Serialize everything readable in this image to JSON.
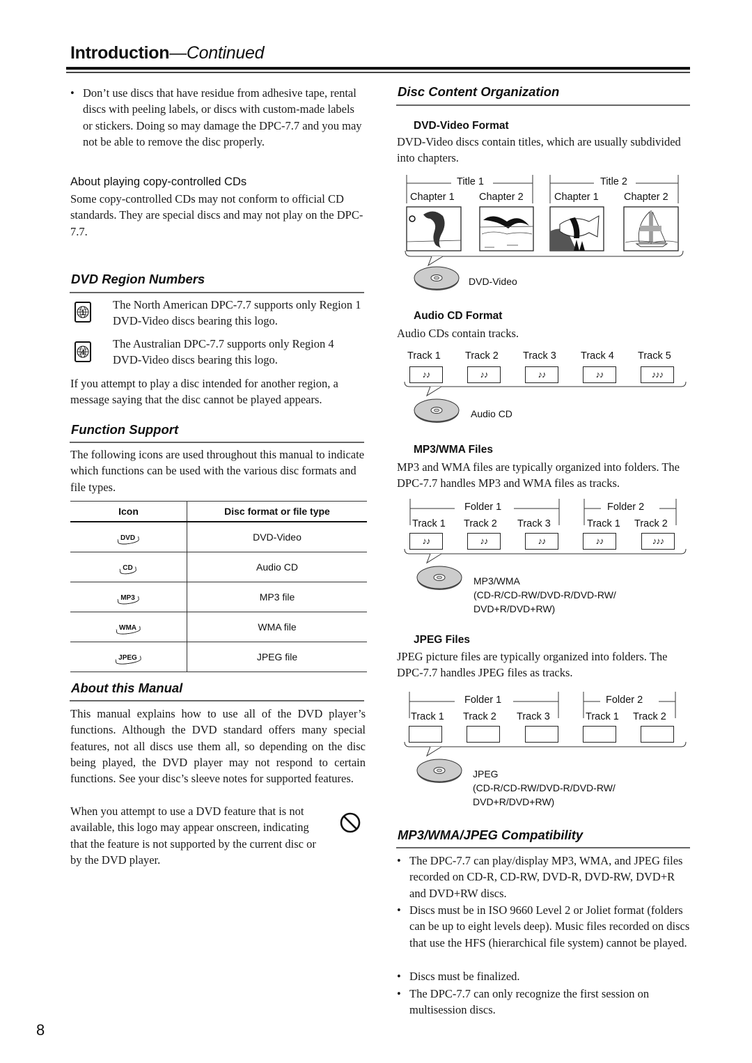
{
  "header": {
    "title": "Introduction",
    "continued": "—Continued"
  },
  "left": {
    "intro_bullet": "Don’t use discs that have residue from adhesive tape, rental discs with peeling labels, or discs with custom-made labels or stickers. Doing so may damage the DPC-7.7 and you may not be able to remove the disc properly.",
    "copy_controlled": {
      "heading": "About playing copy-controlled CDs",
      "text": "Some copy-controlled CDs may not conform to official CD standards. They are special discs and may not play on the DPC-7.7."
    },
    "region": {
      "heading": "DVD Region Numbers",
      "items": [
        {
          "icon": "region-1-globe-icon",
          "number": "1",
          "text": "The North American DPC-7.7 supports only Region 1 DVD-Video discs bearing this logo."
        },
        {
          "icon": "region-4-globe-icon",
          "number": "4",
          "text": "The Australian DPC-7.7 supports only Region 4 DVD-Video discs bearing this logo."
        }
      ],
      "note": "If you attempt to play a disc intended for another region, a message saying that the disc cannot be played appears."
    },
    "function_support": {
      "heading": "Function Support",
      "intro": "The following icons are used throughout this manual to indicate which functions can be used with the various disc formats and file types.",
      "table": {
        "headers": [
          "Icon",
          "Disc format or file type"
        ],
        "rows": [
          {
            "icon": "DVD",
            "type": "DVD-Video"
          },
          {
            "icon": "CD",
            "type": "Audio CD"
          },
          {
            "icon": "MP3",
            "type": "MP3 file"
          },
          {
            "icon": "WMA",
            "type": "WMA file"
          },
          {
            "icon": "JPEG",
            "type": "JPEG file"
          }
        ]
      }
    },
    "about_manual": {
      "heading": "About this Manual",
      "text": "This manual explains how to use all of the DVD player’s functions. Although the DVD standard offers many special features, not all discs use them all, so depending on the disc being played, the DVD player may not respond to certain functions. See your disc’s sleeve notes for supported features.",
      "logo_text": "When you attempt to use a DVD feature that is not available, this logo may appear onscreen, indicating that the feature is not supported by the current disc or by the DVD player.",
      "logo_icon": "prohibited-icon"
    }
  },
  "right": {
    "heading": "Disc Content Organization",
    "dvd": {
      "heading": "DVD-Video Format",
      "text": "DVD-Video discs contain titles, which are usually subdivided into chapters.",
      "titles": [
        {
          "label": "Title 1",
          "chapters": [
            {
              "label": "Chapter 1",
              "image": "dolphin"
            },
            {
              "label": "Chapter 2",
              "image": "bird-over-sea"
            }
          ]
        },
        {
          "label": "Title 2",
          "chapters": [
            {
              "label": "Chapter 1",
              "image": "tropical-fish"
            },
            {
              "label": "Chapter 2",
              "image": "sailboat"
            }
          ]
        }
      ],
      "disc_label": "DVD-Video"
    },
    "audio_cd": {
      "heading": "Audio CD Format",
      "text": "Audio CDs contain tracks.",
      "tracks": [
        {
          "label": "Track 1",
          "notes": "♪♪"
        },
        {
          "label": "Track 2",
          "notes": "♪♪"
        },
        {
          "label": "Track 3",
          "notes": "♪♪"
        },
        {
          "label": "Track 4",
          "notes": "♪♪"
        },
        {
          "label": "Track 5",
          "notes": "♪♪♪"
        }
      ],
      "disc_label": "Audio CD"
    },
    "mp3": {
      "heading": "MP3/WMA Files",
      "text": "MP3 and WMA files are typically organized into folders. The DPC-7.7 handles MP3 and WMA files as tracks.",
      "folders": [
        {
          "label": "Folder 1",
          "tracks": [
            {
              "label": "Track 1",
              "notes": "♪♪"
            },
            {
              "label": "Track 2",
              "notes": "♪♪"
            },
            {
              "label": "Track 3",
              "notes": "♪♪"
            }
          ]
        },
        {
          "label": "Folder 2",
          "tracks": [
            {
              "label": "Track 1",
              "notes": "♪♪"
            },
            {
              "label": "Track 2",
              "notes": "♪♪♪"
            }
          ]
        }
      ],
      "disc_label_1": "MP3/WMA",
      "disc_label_2": "(CD-R/CD-RW/DVD-R/DVD-RW/",
      "disc_label_3": "DVD+R/DVD+RW)"
    },
    "jpeg": {
      "heading": "JPEG Files",
      "text": "JPEG picture files are typically organized into folders. The DPC-7.7 handles JPEG files as tracks.",
      "folders": [
        {
          "label": "Folder 1",
          "tracks": [
            {
              "label": "Track 1"
            },
            {
              "label": "Track 2"
            },
            {
              "label": "Track 3"
            }
          ]
        },
        {
          "label": "Folder 2",
          "tracks": [
            {
              "label": "Track 1"
            },
            {
              "label": "Track 2"
            }
          ]
        }
      ],
      "disc_label_1": "JPEG",
      "disc_label_2": "(CD-R/CD-RW/DVD-R/DVD-RW/",
      "disc_label_3": "DVD+R/DVD+RW)"
    },
    "compat": {
      "heading": "MP3/WMA/JPEG Compatibility",
      "bullets": [
        "The DPC-7.7 can play/display MP3, WMA, and JPEG files recorded on CD-R, CD-RW, DVD-R, DVD-RW, DVD+R and DVD+RW discs.",
        "Discs must be in ISO 9660 Level 2 or Joliet format (folders can be up to eight levels deep). Music files recorded on discs that use the HFS (hierarchical file system) cannot be played.",
        "Discs must be finalized.",
        "The DPC-7.7 can only recognize the first session on multisession discs."
      ]
    }
  },
  "page_number": "8"
}
